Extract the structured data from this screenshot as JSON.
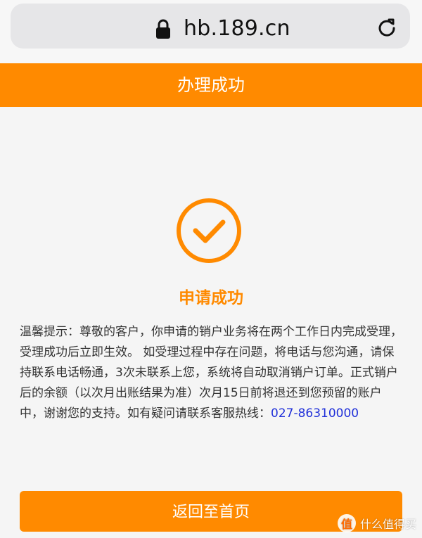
{
  "browser": {
    "url": "hb.189.cn"
  },
  "page": {
    "title": "办理成功",
    "success_title": "申请成功",
    "notice_text": "温馨提示：尊敬的客户，你申请的销户业务将在两个工作日内完成受理，受理成功后立即生效。 如受理过程中存在问题，将电话与您沟通，请保持联系电话畅通，3次未联系上您，系统将自动取消销户订单。正式销户后的余额（以次月出账结果为准）次月15日前将退还到您预留的账户中，谢谢您的支持。如有疑问请联系客服热线：",
    "hotline_number": "027-86310000",
    "home_button_label": "返回至首页"
  },
  "watermark": {
    "badge": "值",
    "text": "什么值得买"
  },
  "colors": {
    "brand_orange": "#ff8a00",
    "hotline_blue": "#2030d9"
  },
  "icons": {
    "lock": "lock-icon",
    "reload": "reload-icon",
    "success": "check-circle-icon"
  }
}
